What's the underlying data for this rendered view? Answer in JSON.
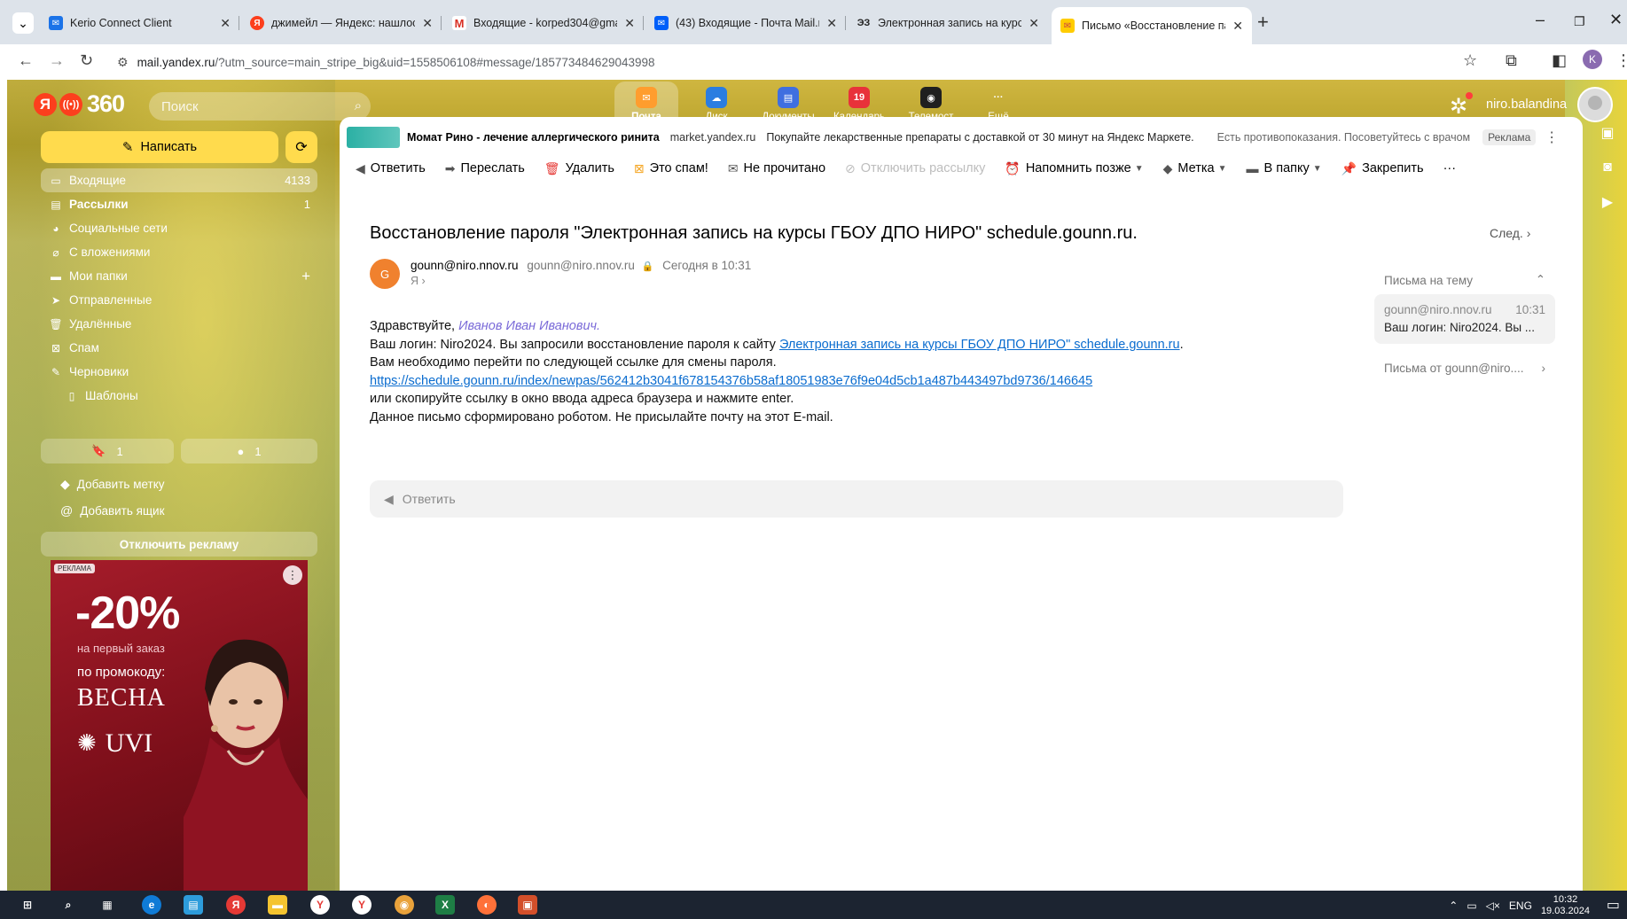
{
  "browser": {
    "tabs": [
      {
        "title": "Kerio Connect Client",
        "active": false
      },
      {
        "title": "джимейл — Яндекс: нашлось",
        "active": false
      },
      {
        "title": "Входящие - korped304@gmail",
        "active": false
      },
      {
        "title": "(43) Входящие - Почта Mail.ru",
        "active": false
      },
      {
        "title": "Электронная запись на курсы",
        "active": false
      },
      {
        "title": "Письмо «Восстановление пар",
        "active": true
      }
    ],
    "url_host": "mail.yandex.ru",
    "url_rest": "/?utm_source=main_stripe_big&uid=1558506108#message/185773484629043998",
    "profile_initial": "K"
  },
  "header": {
    "logo_ya": "Я",
    "logo_num": "360",
    "search_placeholder": "Поиск",
    "services": [
      {
        "label": "Почта",
        "active": true
      },
      {
        "label": "Диск",
        "active": false
      },
      {
        "label": "Документы",
        "active": false
      },
      {
        "label": "Календарь",
        "active": false,
        "badge": "19"
      },
      {
        "label": "Телемост",
        "active": false
      },
      {
        "label": "Ещё",
        "active": false
      }
    ],
    "username": "niro.balandina"
  },
  "sidebar": {
    "compose_label": "Написать",
    "folders": [
      {
        "label": "Входящие",
        "count": "4133",
        "icon": "inbox-icon"
      },
      {
        "label": "Рассылки",
        "count": "1",
        "icon": "newsletter-icon"
      },
      {
        "label": "Социальные сети",
        "count": "",
        "icon": "social-icon"
      },
      {
        "label": "С вложениями",
        "count": "",
        "icon": "attachment-icon"
      },
      {
        "label": "Мои папки",
        "count": "+",
        "icon": "folder-icon"
      },
      {
        "label": "Отправленные",
        "count": "",
        "icon": "sent-icon"
      },
      {
        "label": "Удалённые",
        "count": "",
        "icon": "trash-icon"
      },
      {
        "label": "Спам",
        "count": "",
        "icon": "spam-icon"
      },
      {
        "label": "Черновики",
        "count": "",
        "icon": "drafts-icon"
      },
      {
        "label": "Шаблоны",
        "count": "",
        "icon": "template-icon"
      }
    ],
    "bookmark_count": "1",
    "unread_count": "1",
    "add_label": "Добавить метку",
    "add_box": "Добавить ящик",
    "disable_ads": "Отключить рекламу"
  },
  "banner": {
    "tag": "РЕКЛАМА",
    "discount": "-20%",
    "line1": "на первый заказ",
    "line2": "по промокоду:",
    "code": "ВЕСНА",
    "brand": "UVI"
  },
  "ad": {
    "title": "Момат Рино - лечение аллергического ринита",
    "domain": "market.yandex.ru",
    "desc": "Покупайте лекарственные препараты с доставкой от 30 минут на Яндекс Маркете.",
    "warning": "Есть противопоказания. Посоветуйтесь с врачом",
    "label": "Реклама"
  },
  "toolbar": {
    "reply": "Ответить",
    "forward": "Переслать",
    "delete": "Удалить",
    "spam": "Это спам!",
    "unread": "Не прочитано",
    "unsubscribe": "Отключить рассылку",
    "remind": "Напомнить позже",
    "label": "Метка",
    "to_folder": "В папку",
    "pin": "Закрепить"
  },
  "message": {
    "subject": "Восстановление пароля \"Электронная запись на курсы ГБОУ ДПО НИРО\" schedule.gounn.ru.",
    "next": "След.",
    "avatar_letter": "G",
    "from_name": "gounn@niro.nnov.ru",
    "from_addr": "gounn@niro.nnov.ru",
    "date": "Сегодня в 10:31",
    "to": "Я",
    "greeting": "Здравствуйте, ",
    "greeting_name": "Иванов Иван Иванович.",
    "line2_pre": "Ваш логин: Niro2024. Вы запросили восстановление пароля к сайту ",
    "line2_link": "Электронная запись на курсы ГБОУ ДПО НИРО\" schedule.gounn.ru",
    "line2_post": ".",
    "line3": "Вам необходимо перейти по следующей ссылке для смены пароля.",
    "reset_link": "https://schedule.gounn.ru/index/newpas/562412b3041f678154376b58af18051983e76f9e04d5cb1a487b443497bd9736/146645",
    "line5": "или скопируйте ссылку в окно ввода адреса браузера и нажмите enter.",
    "line6": "Данное письмо сформировано роботом. Не присылайте почту на этот E-mail.",
    "reply_placeholder": "Ответить"
  },
  "thread": {
    "header": "Письма на тему",
    "card_from": "gounn@niro.nnov.ru",
    "card_time": "10:31",
    "card_preview": "Ваш логин: Niro2024. Вы ...",
    "from_all": "Письма от gounn@niro...."
  },
  "taskbar": {
    "lang": "ENG",
    "time": "10:32",
    "date": "19.03.2024"
  }
}
